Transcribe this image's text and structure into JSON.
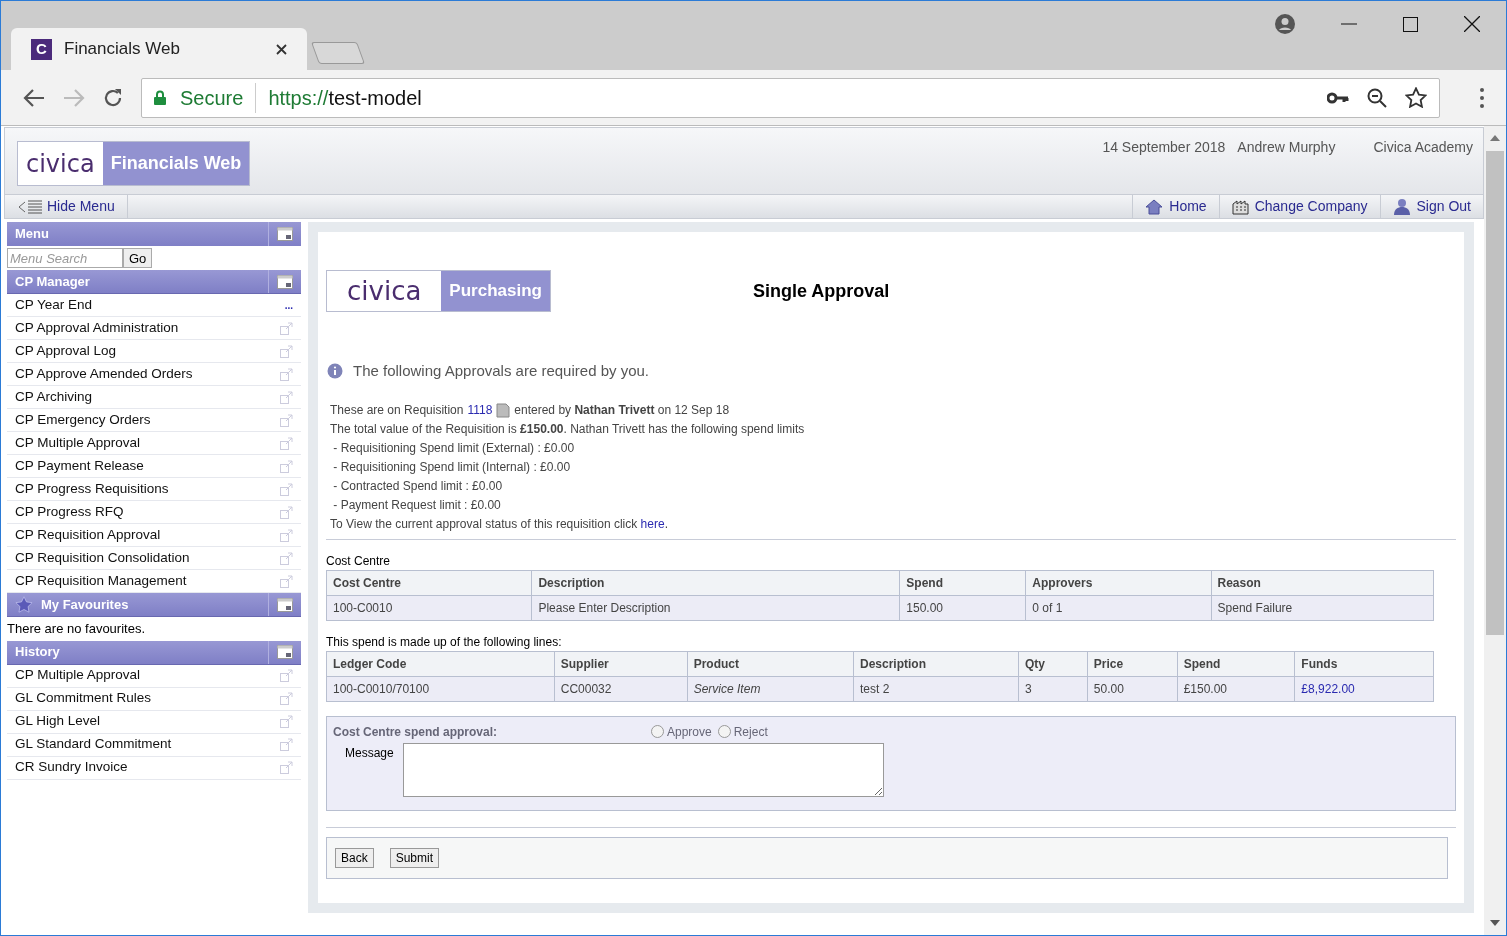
{
  "browser": {
    "tab_title": "Financials Web",
    "tab_logo": "C",
    "secure_label": "Secure",
    "url_scheme": "https://",
    "url_host": "test-model"
  },
  "header": {
    "logo_text": "civica",
    "product": "Financials Web",
    "date": "14 September 2018",
    "user": "Andrew Murphy",
    "company": "Civica Academy",
    "hide_menu": "Hide Menu",
    "nav": [
      {
        "kind": "home",
        "label": "Home"
      },
      {
        "kind": "company",
        "label": "Change Company"
      },
      {
        "kind": "signout",
        "label": "Sign Out"
      }
    ]
  },
  "sidebar": {
    "title": "Menu",
    "search": {
      "placeholder": "Menu Search"
    },
    "go": "Go",
    "sections": [
      {
        "kind": "list",
        "title": "CP Manager",
        "items": [
          {
            "label": "CP Year End",
            "trailing": "..."
          },
          {
            "label": "CP Approval Administration"
          },
          {
            "label": "CP Approval Log"
          },
          {
            "label": "CP Approve Amended Orders"
          },
          {
            "label": "CP Archiving"
          },
          {
            "label": "CP Emergency Orders"
          },
          {
            "label": "CP Multiple Approval"
          },
          {
            "label": "CP Payment Release"
          },
          {
            "label": "CP Progress Requisitions"
          },
          {
            "label": "CP Progress RFQ"
          },
          {
            "label": "CP Requisition Approval"
          },
          {
            "label": "CP Requisition Consolidation"
          },
          {
            "label": "CP Requisition Management"
          }
        ]
      },
      {
        "kind": "favourites",
        "title": "My Favourites",
        "empty_text": "There are no favourites."
      },
      {
        "kind": "list",
        "title": "History",
        "items": [
          {
            "label": "CP Multiple Approval"
          },
          {
            "label": "GL Commitment Rules"
          },
          {
            "label": "GL High Level"
          },
          {
            "label": "GL Standard Commitment"
          },
          {
            "label": "CR Sundry Invoice"
          }
        ]
      }
    ]
  },
  "main": {
    "logo_text": "civica",
    "product": "Purchasing",
    "title": "Single Approval",
    "info": "The following Approvals are required by you.",
    "requisition": {
      "prefix": "These are on Requisition",
      "link": "1118",
      "suffix": "entered by **Nathan Trivett** on 12 Sep 18"
    },
    "lines": [
      "The total value of the Requisition is **£150.00**. Nathan Trivett has the following spend limits",
      " - Requisitioning Spend limit (External) : £0.00",
      " - Requisitioning Spend limit (Internal) : £0.00",
      " - Contracted Spend limit : £0.00",
      " - Payment Request limit : £0.00"
    ],
    "status": {
      "prefix": "To View the current approval status of this requisition click",
      "link": "here",
      "suffix": "."
    },
    "tables": [
      {
        "caption": "Cost Centre",
        "columns": [
          {
            "label": "Cost Centre",
            "kind": "text"
          },
          {
            "label": "Description",
            "kind": "text"
          },
          {
            "label": "Spend",
            "kind": "text"
          },
          {
            "label": "Approvers",
            "kind": "text"
          },
          {
            "label": "Reason",
            "kind": "text"
          }
        ],
        "rows": [
          [
            "100-C0010",
            "Please Enter Description",
            "150.00",
            "0 of 1",
            "Spend Failure"
          ]
        ]
      },
      {
        "caption": "This spend is made up of the following lines:",
        "columns": [
          {
            "label": "Ledger Code",
            "kind": "text"
          },
          {
            "label": "Supplier",
            "kind": "text"
          },
          {
            "label": "Product",
            "kind": "italic"
          },
          {
            "label": "Description",
            "kind": "text"
          },
          {
            "label": "Qty",
            "kind": "text"
          },
          {
            "label": "Price",
            "kind": "text"
          },
          {
            "label": "Spend",
            "kind": "text"
          },
          {
            "label": "Funds",
            "kind": "link"
          }
        ],
        "rows": [
          [
            "100-C0010/70100",
            "CC00032",
            "Service Item",
            "test 2",
            "3",
            "50.00",
            "£150.00",
            "£8,922.00"
          ]
        ]
      }
    ],
    "approval": {
      "label": "Cost Centre spend approval:",
      "options": [
        {
          "label": "Approve",
          "selected": false
        },
        {
          "label": "Reject",
          "selected": false
        }
      ],
      "message_label": "Message"
    },
    "buttons": [
      "Back",
      "Submit"
    ]
  }
}
